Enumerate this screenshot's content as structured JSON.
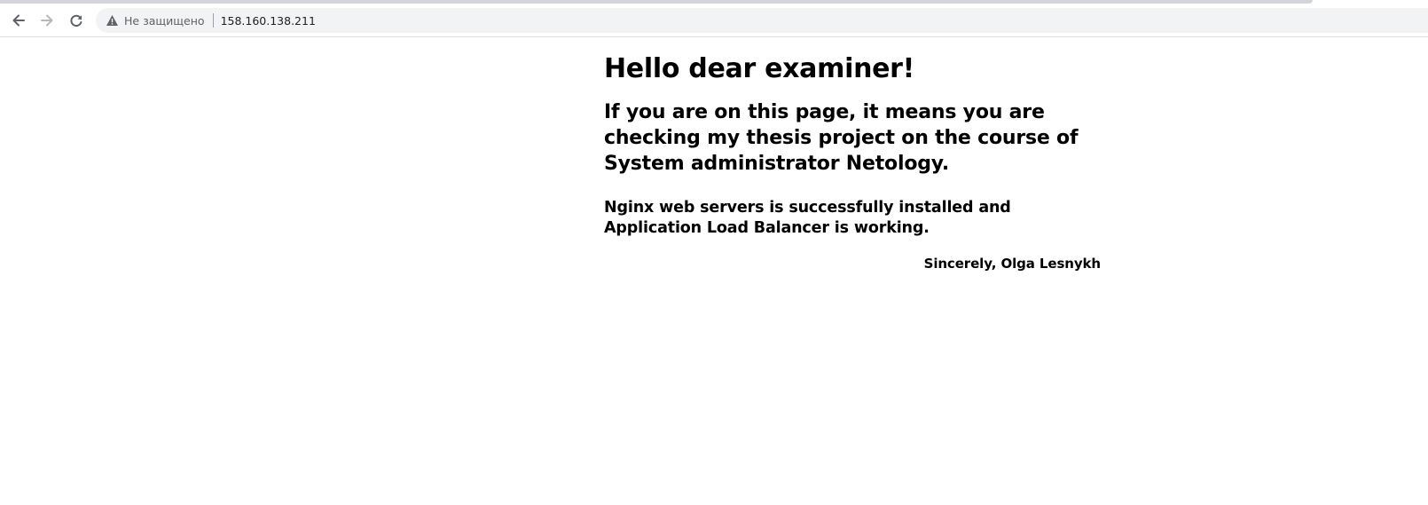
{
  "browser": {
    "security_label": "Не защищено",
    "url": "158.160.138.211",
    "icons": {
      "back": "back-arrow-icon",
      "forward": "forward-arrow-icon",
      "reload": "reload-icon",
      "warning": "warning-icon"
    }
  },
  "page": {
    "heading": "Hello dear examiner!",
    "subheading": "If you are on this page, it means you are checking my thesis project on the course of System administrator Netology.",
    "status": "Nginx web servers is successfully installed and Application Load Balancer is working.",
    "signature": "Sincerely, Olga Lesnykh"
  }
}
